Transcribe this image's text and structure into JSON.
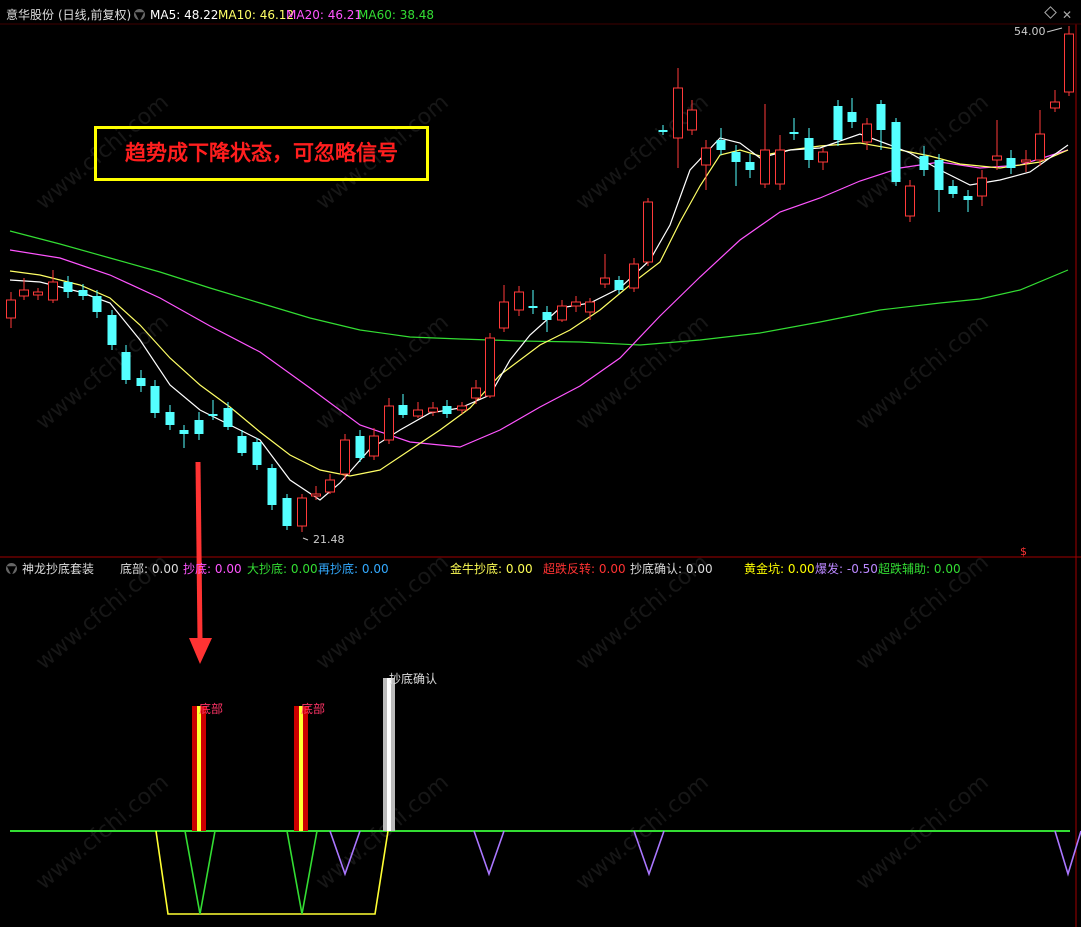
{
  "header": {
    "stock_name": "意华股份",
    "period": "(日线,前复权)",
    "ma": [
      {
        "label": "MA5:",
        "value": "48.22",
        "color": "#ffffff"
      },
      {
        "label": "MA10:",
        "value": "46.12",
        "color": "#ffff66"
      },
      {
        "label": "MA20:",
        "value": "46.21",
        "color": "#ff55ff"
      },
      {
        "label": "MA60:",
        "value": "38.48",
        "color": "#33dd33"
      }
    ]
  },
  "alert": {
    "text": "趋势成下降状态，可忽略信号"
  },
  "price_labels": {
    "high": "54.00",
    "low": "21.48",
    "dollar": "$"
  },
  "indicator": {
    "name": "神龙抄底套装",
    "fields": [
      {
        "label": "底部:",
        "value": "0.00",
        "color": "#dddddd"
      },
      {
        "label": "抄底:",
        "value": "0.00",
        "color": "#ff55ff"
      },
      {
        "label": "大抄底:",
        "value": "0.00",
        "color": "#33dd33"
      },
      {
        "label": "再抄底:",
        "value": "0.00",
        "color": "#33aaff"
      },
      {
        "label": "金牛抄底:",
        "value": "0.00",
        "color": "#ffff55"
      },
      {
        "label": "超跌反转:",
        "value": "0.00",
        "color": "#ff3333"
      },
      {
        "label": "抄底确认:",
        "value": "0.00",
        "color": "#dddddd"
      },
      {
        "label": "黄金坑:",
        "value": "0.00",
        "color": "#ffff00"
      },
      {
        "label": "爆发:",
        "value": "-0.50",
        "color": "#bb88ff"
      },
      {
        "label": "超跌辅助:",
        "value": "0.00",
        "color": "#33dd33"
      }
    ],
    "bar_labels": [
      "底部",
      "底部",
      "抄底确认"
    ]
  },
  "watermark": "www.cfchi.com",
  "colors": {
    "up": "#ff3a3a",
    "down": "#54ffff",
    "ma5": "#ffffff",
    "ma10": "#ffff66",
    "ma20": "#ff55ff",
    "ma60": "#33dd33",
    "arrow": "#ff3333"
  }
}
